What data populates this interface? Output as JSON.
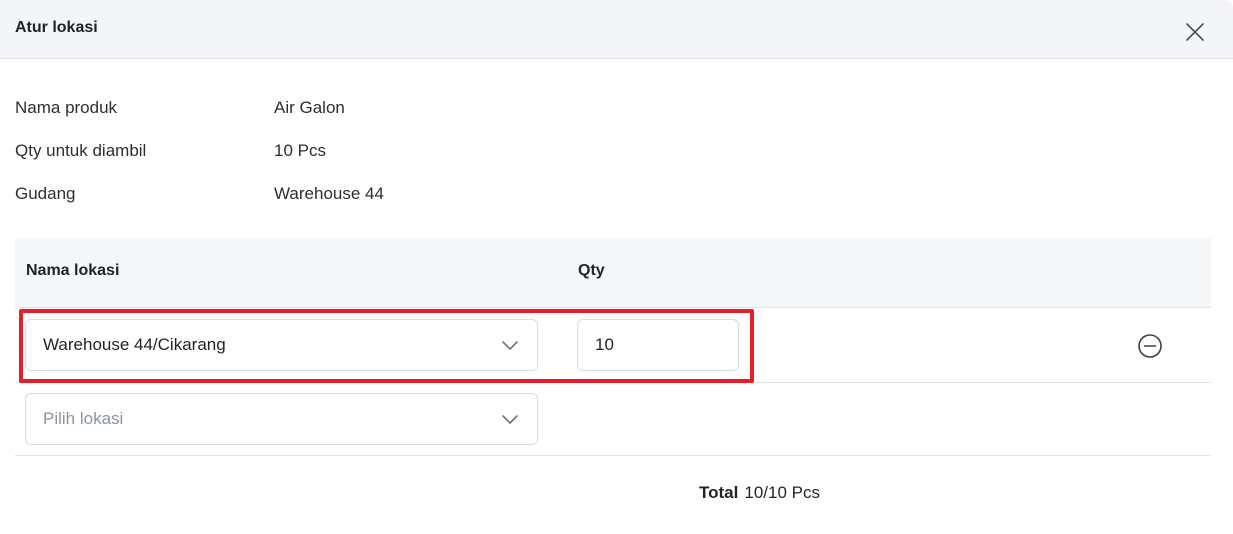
{
  "modal": {
    "title": "Atur lokasi"
  },
  "info": {
    "product_label": "Nama produk",
    "product_value": "Air Galon",
    "qty_label": "Qty untuk diambil",
    "qty_value": "10 Pcs",
    "warehouse_label": "Gudang",
    "warehouse_value": "Warehouse 44"
  },
  "table": {
    "headers": {
      "location": "Nama lokasi",
      "qty": "Qty"
    },
    "rows": [
      {
        "location": "Warehouse 44/Cikarang",
        "qty": "10"
      }
    ],
    "new_row_placeholder": "Pilih lokasi"
  },
  "total": {
    "label": "Total",
    "value": "10/10 Pcs"
  },
  "icons": {
    "close": "close-icon",
    "chevron": "chevron-down-icon",
    "remove": "minus-circle-icon"
  },
  "colors": {
    "highlight": "#e3202a",
    "header_bg": "#f3f5f8",
    "placeholder": "#8a94a3"
  }
}
